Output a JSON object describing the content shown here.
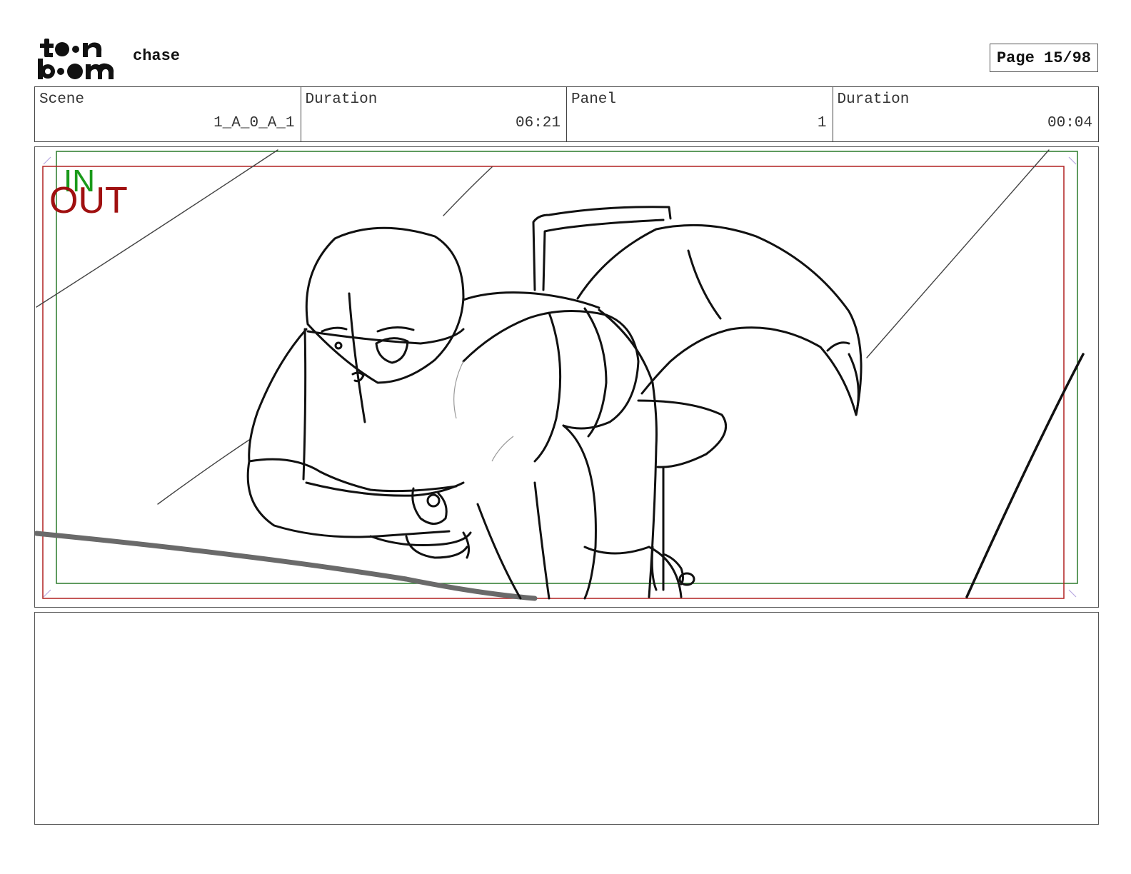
{
  "header": {
    "logo_text": "toon boom",
    "project_title": "chase",
    "page_label": "Page 15/98"
  },
  "info": {
    "scene_label": "Scene",
    "scene_value": "1_A_0_A_1",
    "scene_duration_label": "Duration",
    "scene_duration_value": "06:21",
    "panel_label": "Panel",
    "panel_value": "1",
    "panel_duration_label": "Duration",
    "panel_duration_value": "00:04"
  },
  "panel": {
    "in_label": "IN",
    "out_label": "OUT",
    "in_color": "#1a9a1a",
    "out_color": "#a01010"
  },
  "notes": {
    "text": ""
  }
}
